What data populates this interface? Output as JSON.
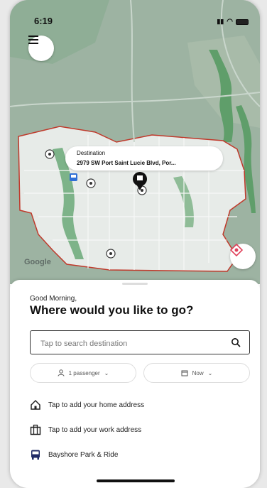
{
  "status_bar": {
    "time": "6:19"
  },
  "map": {
    "destination_label": "Destination",
    "destination_address": "2979 SW Port Saint Lucie Blvd, Por...",
    "attribution": "Google",
    "service_area_color": "#c0392b",
    "road_color": "#e6ece8"
  },
  "sheet": {
    "greeting": "Good Morning,",
    "question": "Where would you like to go?",
    "search_placeholder": "Tap to search destination",
    "passenger_label": "1 passenger",
    "time_label": "Now",
    "home_row": "Tap to add your home address",
    "work_row": "Tap to add your work address",
    "saved_place": "Bayshore Park & Ride"
  }
}
